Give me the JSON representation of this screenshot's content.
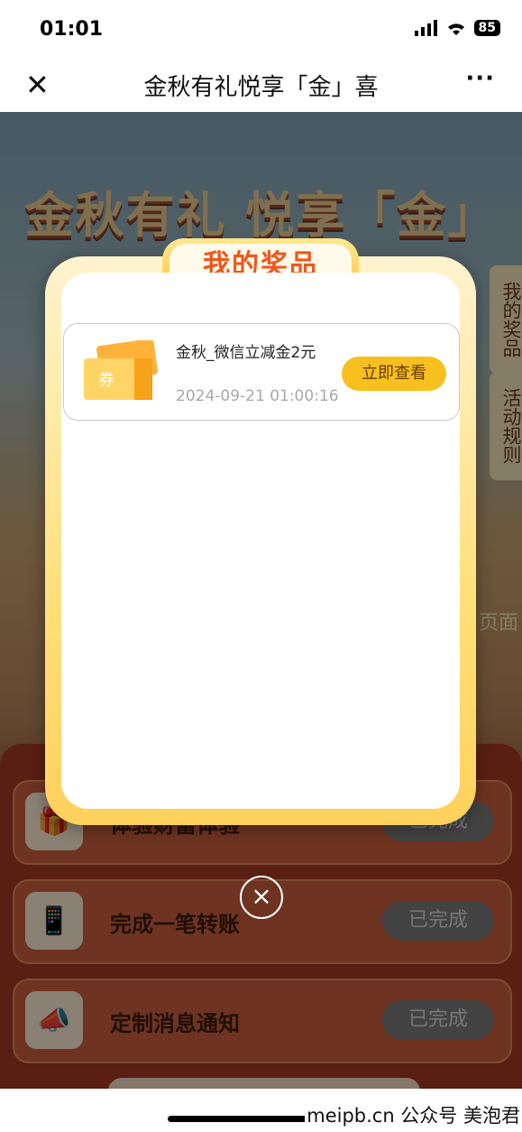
{
  "status_bar": {
    "time": "01:01",
    "battery": "85"
  },
  "nav": {
    "close_icon": "close-icon",
    "title": "金秋有礼悦享「金」喜",
    "more": "···"
  },
  "background": {
    "hero_title": "金秋有礼 悦享「金」喜",
    "side_tabs": [
      "我的奖品",
      "活动规则"
    ],
    "back_home": "页面",
    "tasks": [
      {
        "label": "体验财富体验",
        "status": "已完成",
        "icon": "gift-icon"
      },
      {
        "label": "完成一笔转账",
        "status": "已完成",
        "icon": "phone-transfer-icon"
      },
      {
        "label": "定制消息通知",
        "status": "已完成",
        "icon": "megaphone-icon"
      }
    ]
  },
  "modal": {
    "title": "我的奖品",
    "prize": {
      "icon": "coupon-icon",
      "coupon_text": "券",
      "name": "金秋_微信立减金2元",
      "date": "2024-09-21 01:00:16",
      "button": "立即查看"
    },
    "close": "×"
  },
  "watermark": "meipb.cn 公众号 美泡君"
}
